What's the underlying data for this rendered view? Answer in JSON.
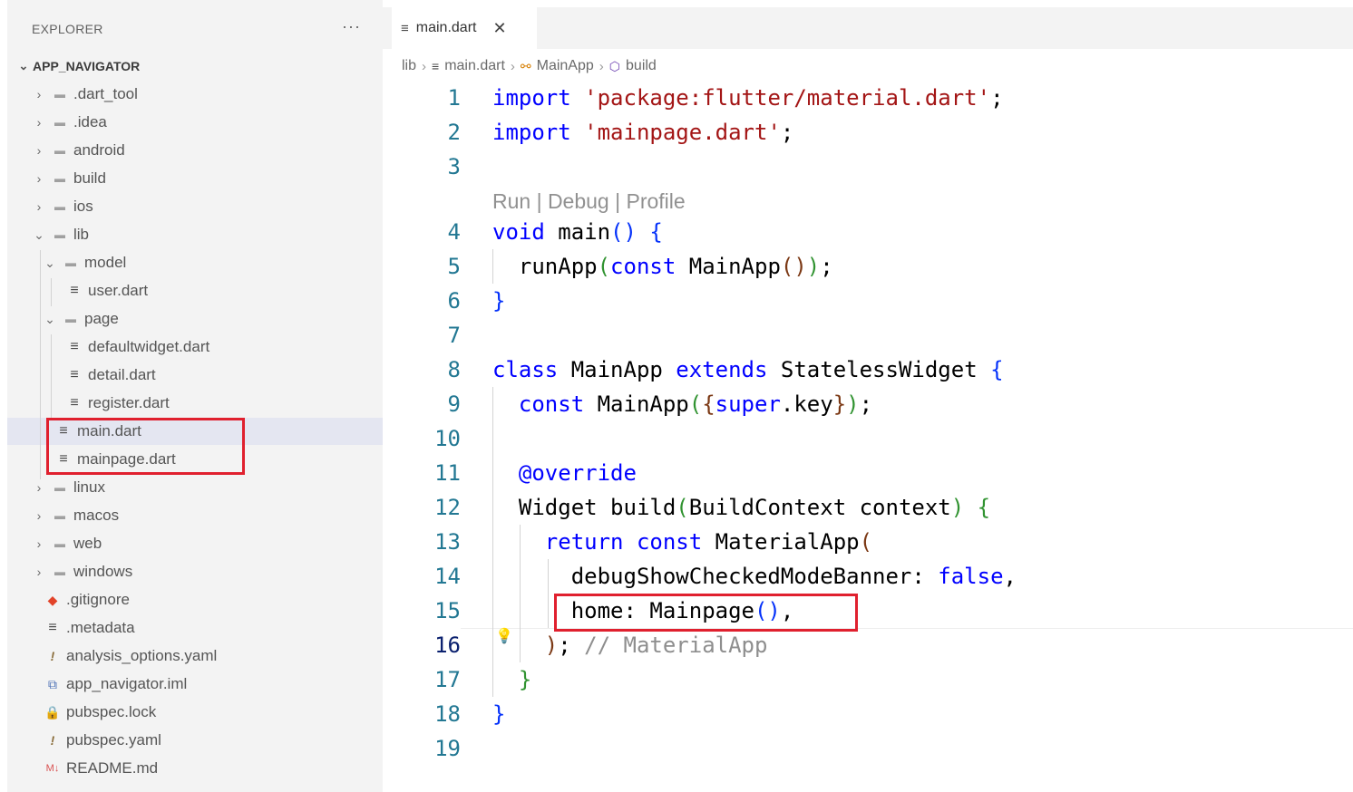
{
  "sidebar": {
    "title": "EXPLORER",
    "more": "···",
    "root": "APP_NAVIGATOR",
    "items": [
      {
        "label": ".dart_tool",
        "type": "folder",
        "state": "collapsed"
      },
      {
        "label": ".idea",
        "type": "folder",
        "state": "collapsed"
      },
      {
        "label": "android",
        "type": "folder",
        "state": "collapsed"
      },
      {
        "label": "build",
        "type": "folder",
        "state": "collapsed"
      },
      {
        "label": "ios",
        "type": "folder",
        "state": "collapsed"
      },
      {
        "label": "lib",
        "type": "folder",
        "state": "expanded"
      },
      {
        "label": "model",
        "type": "folder",
        "state": "expanded"
      },
      {
        "label": "user.dart",
        "type": "file"
      },
      {
        "label": "page",
        "type": "folder",
        "state": "expanded"
      },
      {
        "label": "defaultwidget.dart",
        "type": "file"
      },
      {
        "label": "detail.dart",
        "type": "file"
      },
      {
        "label": "register.dart",
        "type": "file"
      },
      {
        "label": "main.dart",
        "type": "file",
        "selected": true
      },
      {
        "label": "mainpage.dart",
        "type": "file"
      },
      {
        "label": "linux",
        "type": "folder",
        "state": "collapsed"
      },
      {
        "label": "macos",
        "type": "folder",
        "state": "collapsed"
      },
      {
        "label": "web",
        "type": "folder",
        "state": "collapsed"
      },
      {
        "label": "windows",
        "type": "folder",
        "state": "collapsed"
      },
      {
        "label": ".gitignore",
        "type": "file",
        "icon": "git-icon"
      },
      {
        "label": ".metadata",
        "type": "file"
      },
      {
        "label": "analysis_options.yaml",
        "type": "file",
        "icon": "yaml-icon"
      },
      {
        "label": "app_navigator.iml",
        "type": "file",
        "icon": "xml-icon"
      },
      {
        "label": "pubspec.lock",
        "type": "file",
        "icon": "lock-icon"
      },
      {
        "label": "pubspec.yaml",
        "type": "file",
        "icon": "yaml-icon"
      },
      {
        "label": "README.md",
        "type": "file",
        "icon": "markdown-icon"
      }
    ]
  },
  "editor": {
    "tab": {
      "label": "main.dart",
      "close": "✕"
    },
    "breadcrumb": [
      "lib",
      "main.dart",
      "MainApp",
      "build"
    ],
    "codelens": "Run | Debug | Profile",
    "line_numbers": [
      "1",
      "2",
      "3",
      "4",
      "5",
      "6",
      "7",
      "8",
      "9",
      "10",
      "11",
      "12",
      "13",
      "14",
      "15",
      "16",
      "17",
      "18",
      "19"
    ],
    "active_line": "16"
  },
  "colors": {
    "keyword": "#0000ff",
    "string": "#a31515",
    "line_number": "#237893",
    "highlight_box": "#e0202e",
    "selection": "#e4e6f1"
  }
}
